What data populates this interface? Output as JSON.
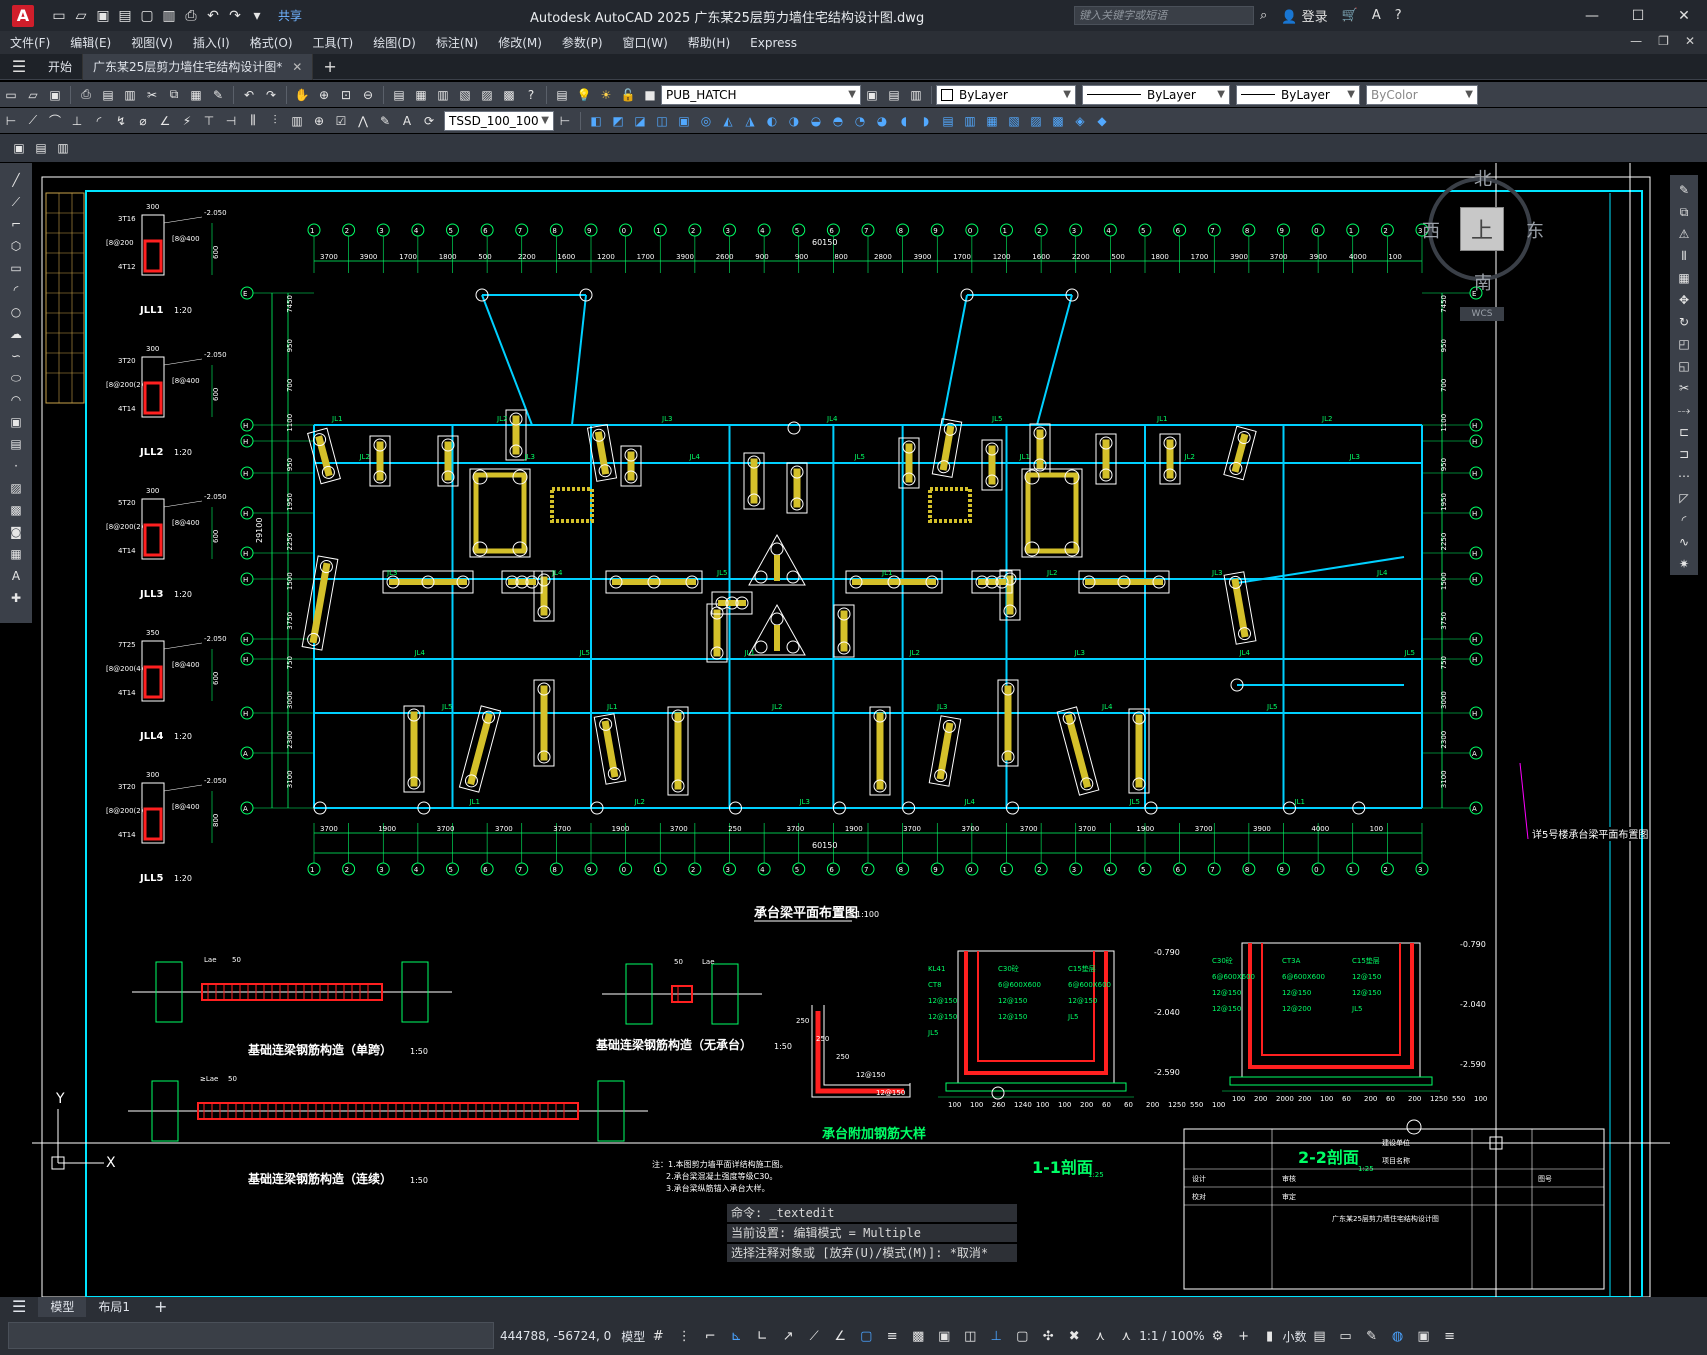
{
  "app": {
    "title": "Autodesk AutoCAD 2025    广东某25层剪力墙住宅结构设计图.dwg",
    "share_label": "共享",
    "search_placeholder": "键入关键字或短语",
    "login_label": "登录"
  },
  "menu": [
    "文件(F)",
    "编辑(E)",
    "视图(V)",
    "插入(I)",
    "格式(O)",
    "工具(T)",
    "绘图(D)",
    "标注(N)",
    "修改(M)",
    "参数(P)",
    "窗口(W)",
    "帮助(H)",
    "Express"
  ],
  "tabs": {
    "start": "开始",
    "drawing": "广东某25层剪力墙住宅结构设计图*"
  },
  "toolbar": {
    "layer": "PUB_HATCH",
    "color": "ByLayer",
    "linetype": "ByLayer",
    "lineweight": "ByLayer",
    "plotstyle": "ByColor",
    "dimstyle": "TSSD_100_100"
  },
  "viewcube": {
    "north": "北",
    "south": "南",
    "east": "东",
    "west": "西",
    "top": "上",
    "wcs": "WCS"
  },
  "drawing": {
    "plan_title": "承台梁平面布置图",
    "plan_scale": "1:100",
    "plan_note": "详5号楼承台梁平面布置图",
    "overall_dim": "60150",
    "height_dim": "29100",
    "axis_top": [
      "1",
      "2",
      "3",
      "4",
      "5",
      "6",
      "7",
      "8",
      "9",
      "10",
      "11",
      "12",
      "13",
      "14",
      "15",
      "16",
      "17",
      "18",
      "19",
      "20",
      "21",
      "22",
      "23",
      "24",
      "25",
      "26",
      "27",
      "28",
      "29",
      "30",
      "31",
      "32",
      "33"
    ],
    "axis_left": [
      "E",
      "H",
      "H",
      "H",
      "H",
      "H",
      "H",
      "H",
      "H",
      "H",
      "A"
    ],
    "top_dims": [
      "3700",
      "3900",
      "1700",
      "1800",
      "500",
      "2200",
      "1600",
      "1200",
      "1700",
      "3900",
      "2600",
      "900",
      "900",
      "800",
      "2800",
      "3900",
      "1700",
      "1200",
      "1600",
      "2200",
      "500",
      "1800",
      "1700",
      "3900",
      "3700",
      "3900",
      "4000",
      "100"
    ],
    "bottom_dims": [
      "3700",
      "1900",
      "3700",
      "3700",
      "3700",
      "1900",
      "3700",
      "250",
      "3700",
      "1900",
      "3700",
      "3700",
      "3700",
      "3700",
      "1900",
      "3700",
      "3900",
      "4000",
      "100"
    ],
    "side_dims": [
      "7450",
      "950",
      "700",
      "1100",
      "950",
      "1950",
      "2250",
      "1500",
      "3750",
      "750",
      "3000",
      "2300",
      "3100"
    ],
    "beam_labels": [
      "JL1",
      "JL2",
      "JL3",
      "JL4",
      "JL5"
    ],
    "sections_left": [
      {
        "name": "JLL1",
        "scale": "1:20",
        "top": "3T16",
        "bot": "4T12",
        "side": "[8@200",
        "stir": "[8@400",
        "w": "300",
        "h": "600",
        "elev": "-2.050"
      },
      {
        "name": "JLL2",
        "scale": "1:20",
        "top": "3T20",
        "bot": "4T14",
        "side": "[8@200(2)",
        "stir": "[8@400",
        "w": "300",
        "h": "600",
        "elev": "-2.050"
      },
      {
        "name": "JLL3",
        "scale": "1:20",
        "top": "5T20",
        "bot": "4T14",
        "side": "[8@200(2)",
        "stir": "[8@400",
        "w": "300",
        "h": "600",
        "elev": "-2.050"
      },
      {
        "name": "JLL4",
        "scale": "1:20",
        "top": "7T25",
        "bot": "4T14",
        "side": "[8@200(4)",
        "stir": "[8@400",
        "w": "350",
        "h": "600",
        "elev": "-2.050"
      },
      {
        "name": "JLL5",
        "scale": "1:20",
        "top": "3T20",
        "bot": "4T14",
        "side": "[8@200(2)",
        "stir": "[8@400",
        "w": "300",
        "h": "800",
        "elev": "-2.050"
      }
    ],
    "detail_titles": [
      {
        "text": "基础连梁钢筋构造（单跨）",
        "scale": "1:50"
      },
      {
        "text": "基础连梁钢筋构造（无承台）",
        "scale": "1:50"
      },
      {
        "text": "基础连梁钢筋构造（连续）",
        "scale": "1:50"
      }
    ],
    "detail_labels": [
      "Lae",
      "50",
      "50",
      "Lae",
      "50",
      "≥Lae",
      "50",
      "50",
      "≥Lae",
      "50"
    ],
    "section11": {
      "title": "1-1剖面",
      "scale": "1:25",
      "labels": [
        "KL41",
        "C30砼",
        "C15垫层",
        "CT8",
        "6@600X600",
        "6@600X600",
        "12@150",
        "12@150",
        "12@150",
        "12@150",
        "12@150",
        "JL5",
        "JL5"
      ],
      "elevs": [
        "-0.790",
        "-2.040",
        "-2.590"
      ],
      "dims": [
        "100",
        "100",
        "260",
        "1240",
        "100",
        "100",
        "200",
        "60",
        "60",
        "200",
        "1250",
        "550",
        "100"
      ]
    },
    "section22": {
      "title": "2-2剖面",
      "scale": "1:25",
      "labels": [
        "C30砼",
        "CT3A",
        "C15垫层",
        "6@600X600",
        "6@600X600",
        "12@150",
        "12@150",
        "12@150",
        "12@150",
        "12@150",
        "12@200",
        "JL5"
      ],
      "elevs": [
        "-0.790",
        "-2.040",
        "-2.590"
      ],
      "dims": [
        "100",
        "200",
        "2000",
        "200",
        "100",
        "60",
        "200",
        "60",
        "200",
        "1250",
        "550",
        "100"
      ]
    },
    "detail_rebar": {
      "title": "承台附加钢筋大样",
      "dims": [
        "250",
        "250",
        "250",
        "12@150",
        "12@150"
      ]
    },
    "notes": [
      "注：1.本图剪力墙平面详结构施工图。",
      "2.承台梁混凝土强度等级C30。",
      "3.承台梁纵筋锚入承台大样。"
    ],
    "titleblock": [
      "建设单位",
      "项目名称",
      "设计",
      "校对",
      "审核",
      "审定",
      "图号",
      "广东某25层剪力墙住宅结构设计图"
    ]
  },
  "command": {
    "line1": "命令:  _textedit",
    "line2": "当前设置: 编辑模式 = Multiple",
    "line3": "选择注释对象或 [放弃(U)/模式(M)]: *取消*"
  },
  "layout_tabs": [
    "模型",
    "布局1"
  ],
  "status": {
    "coords": "444788, -56724, 0",
    "model": "模型",
    "scale": "1:1 / 100%",
    "units": "小数"
  }
}
